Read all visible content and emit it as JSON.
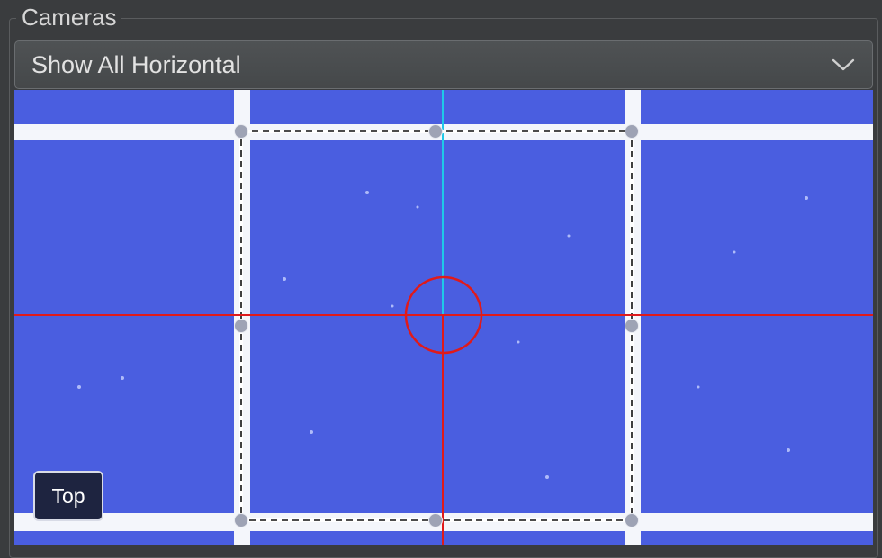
{
  "group": {
    "title": "Cameras"
  },
  "camera_select": {
    "selected": "Show All Horizontal"
  },
  "view": {
    "label": "Top"
  },
  "colors": {
    "background": "#3a3c3e",
    "tape_blue": "#4a5ee0",
    "grid_white": "#f4f6fb",
    "crosshair_red": "#e01a1a",
    "center_line_cyan": "#1fc9e8",
    "handle_gray": "#9ea3b5"
  },
  "icons": {
    "dropdown": "chevron-down-icon"
  }
}
